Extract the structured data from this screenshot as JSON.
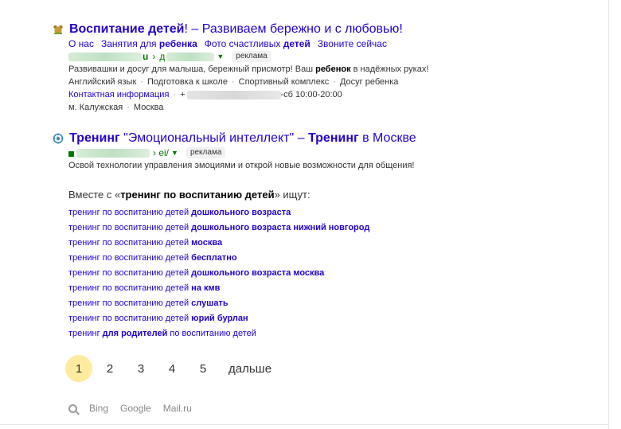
{
  "result1": {
    "title_bold": "Воспитание детей",
    "title_rest": "! – Развиваем бережно и с любовью!",
    "sitelinks": [
      {
        "plain": "О нас",
        "bold": ""
      },
      {
        "plain": "Занятия для ",
        "bold": "ребенка"
      },
      {
        "plain": "Фото счастливых ",
        "bold": "детей"
      },
      {
        "plain": "Звоните сейчас",
        "bold": ""
      }
    ],
    "url_mid": "u",
    "url_sep": "›",
    "url_tail": "д",
    "ad_label": "реклама",
    "snippet_a": "Развивашки и досуг для малыша, бережный присмотр! Ваш ",
    "snippet_b": "ребенок",
    "snippet_c": " в надёжных руках!",
    "tags": [
      "Английский язык",
      "Подготовка к школе",
      "Спортивный комплекс",
      "Досуг ребенка"
    ],
    "contacts_link": "Контактная информация",
    "phone_prefix": "+",
    "hours": "-сб 10:00-20:00",
    "address": [
      "м. Калужская",
      "Москва"
    ]
  },
  "result2": {
    "title_a": "Тренинг",
    "title_b": " \"Эмоциональный интеллект\" – ",
    "title_c": "Тренинг",
    "title_d": " в Москве",
    "url_tail": "› ei/",
    "ad_label": "реклама",
    "snippet": "Освой технологии управления эмоциями и открой новые возможности для общения!"
  },
  "related": {
    "head_a": "Вместе с «",
    "head_b": "тренинг по воспитанию детей",
    "head_c": "» ищут:",
    "items": [
      {
        "plain": "тренинг по воспитанию детей ",
        "bold": "дошкольного возраста",
        "after": ""
      },
      {
        "plain": "тренинг по воспитанию детей ",
        "bold": "дошкольного возраста нижний новгород",
        "after": ""
      },
      {
        "plain": "тренинг по воспитанию детей ",
        "bold": "москва",
        "after": ""
      },
      {
        "plain": "тренинг по воспитанию детей ",
        "bold": "бесплатно",
        "after": ""
      },
      {
        "plain": "тренинг по воспитанию детей ",
        "bold": "дошкольного возраста москва",
        "after": ""
      },
      {
        "plain": "тренинг по воспитанию детей ",
        "bold": "на кмв",
        "after": ""
      },
      {
        "plain": "тренинг по воспитанию детей ",
        "bold": "слушать",
        "after": ""
      },
      {
        "plain": "тренинг по воспитанию детей ",
        "bold": "юрий бурлан",
        "after": ""
      },
      {
        "plain": "тренинг ",
        "bold": "для родителей",
        "after": " по воспитанию детей"
      }
    ]
  },
  "pager": {
    "pages": [
      "1",
      "2",
      "3",
      "4",
      "5"
    ],
    "current": "1",
    "next": "дальше"
  },
  "engines": [
    "Bing",
    "Google",
    "Mail.ru"
  ],
  "colors": {
    "link": "#2200cc",
    "url": "#007700",
    "current_page": "#ffeba0"
  }
}
